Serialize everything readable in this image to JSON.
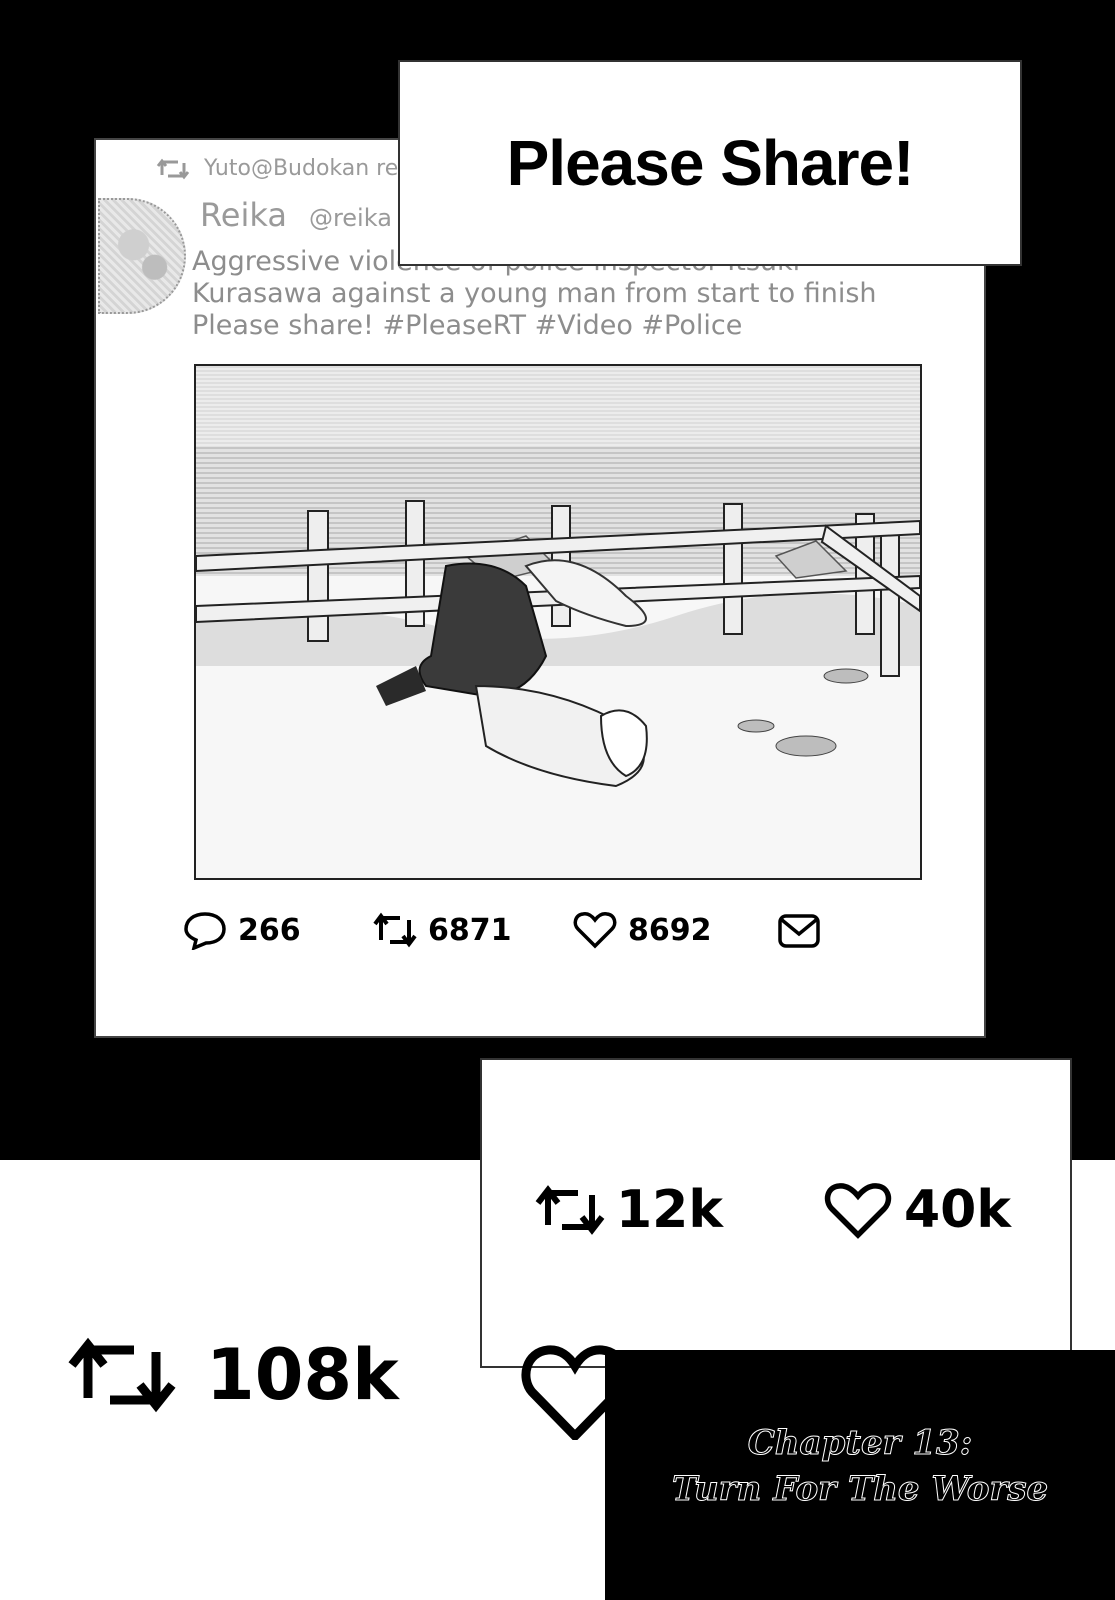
{
  "headline": "Please Share!",
  "tweet": {
    "retweeted_by": "Yuto@Budokan re",
    "display_name": "Reika",
    "handle": "@reika",
    "text_lines": [
      "Aggressive violence of police inspector Itsuki",
      "Kurasawa against a young man from start to finish",
      "Please share! #PleaseRT #Video #Police"
    ],
    "replies": "266",
    "retweets": "6871",
    "likes": "8692"
  },
  "stats": {
    "retweets": "12k",
    "likes": "40k"
  },
  "big_retweets": "108k",
  "chapter": {
    "line1": "Chapter 13:",
    "line2": "Turn For The Worse"
  },
  "icons": [
    "retweet-icon",
    "reply-icon",
    "heart-icon",
    "mail-icon"
  ]
}
